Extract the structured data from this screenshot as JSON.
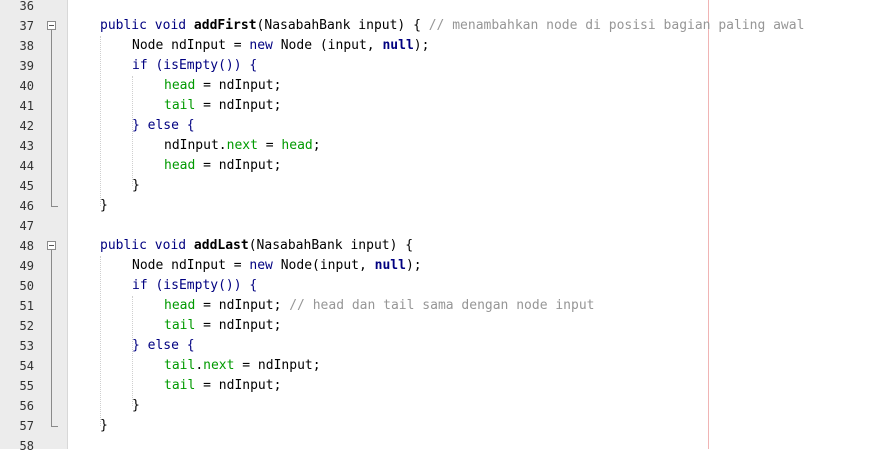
{
  "editor": {
    "colors": {
      "gutter": "#ececec",
      "keyword": "#000080",
      "field": "#009a00",
      "comment": "#969696",
      "margin_line": "#f0b4b4"
    },
    "line_numbers": [
      "36",
      "37",
      "38",
      "39",
      "40",
      "41",
      "42",
      "43",
      "44",
      "45",
      "46",
      "47",
      "48",
      "49",
      "50",
      "51",
      "52",
      "53",
      "54",
      "55",
      "56",
      "57",
      "58"
    ],
    "code": {
      "l37": {
        "a": "public void ",
        "method": "addFirst",
        "b": "(NasabahBank input) { ",
        "comment": "// menambahkan node di posisi bagian paling awal"
      },
      "l38": {
        "a": "Node ndInput = ",
        "kw": "new",
        "b": " Node (input, ",
        "null": "null",
        "c": ");"
      },
      "l39": {
        "a": "if (isEmpty()) {"
      },
      "l40": {
        "field": "head",
        "b": " = ndInput;"
      },
      "l41": {
        "field": "tail",
        "b": " = ndInput;"
      },
      "l42": {
        "a": "} else {"
      },
      "l43": {
        "a": "ndInput.",
        "field1": "next",
        "b": " = ",
        "field2": "head",
        "c": ";"
      },
      "l44": {
        "field": "head",
        "b": " = ndInput;"
      },
      "l45": {
        "a": "}"
      },
      "l46": {
        "a": "}"
      },
      "l48": {
        "a": "public void ",
        "method": "addLast",
        "b": "(NasabahBank input) {"
      },
      "l49": {
        "a": "Node ndInput = ",
        "kw": "new",
        "b": " Node(input, ",
        "null": "null",
        "c": ");"
      },
      "l50": {
        "a": "if (isEmpty()) {"
      },
      "l51": {
        "field": "head",
        "b": " = ndInput; ",
        "comment": "// head dan tail sama dengan node input"
      },
      "l52": {
        "field": "tail",
        "b": " = ndInput;"
      },
      "l53": {
        "a": "} else {"
      },
      "l54": {
        "field1": "tail",
        "a": ".",
        "field2": "next",
        "b": " = ndInput;"
      },
      "l55": {
        "field": "tail",
        "b": " = ndInput;"
      },
      "l56": {
        "a": "}"
      },
      "l57": {
        "a": "}"
      }
    }
  }
}
